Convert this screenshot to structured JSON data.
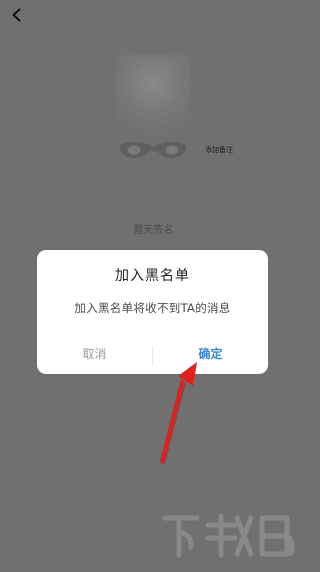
{
  "profile": {
    "add_remark": "添加备注",
    "no_signature": "暂无签名"
  },
  "dialog": {
    "title": "加入黑名单",
    "message": "加入黑名单将收不到TA的消息",
    "cancel_label": "取消",
    "confirm_label": "确定"
  },
  "watermark": {
    "text": "下载吧"
  },
  "colors": {
    "confirm_blue": "#3d86d6",
    "arrow_red": "#e0211f"
  },
  "icons": {
    "back": "chevron-left-icon",
    "mask": "mask-icon",
    "arrow": "arrow-icon"
  }
}
